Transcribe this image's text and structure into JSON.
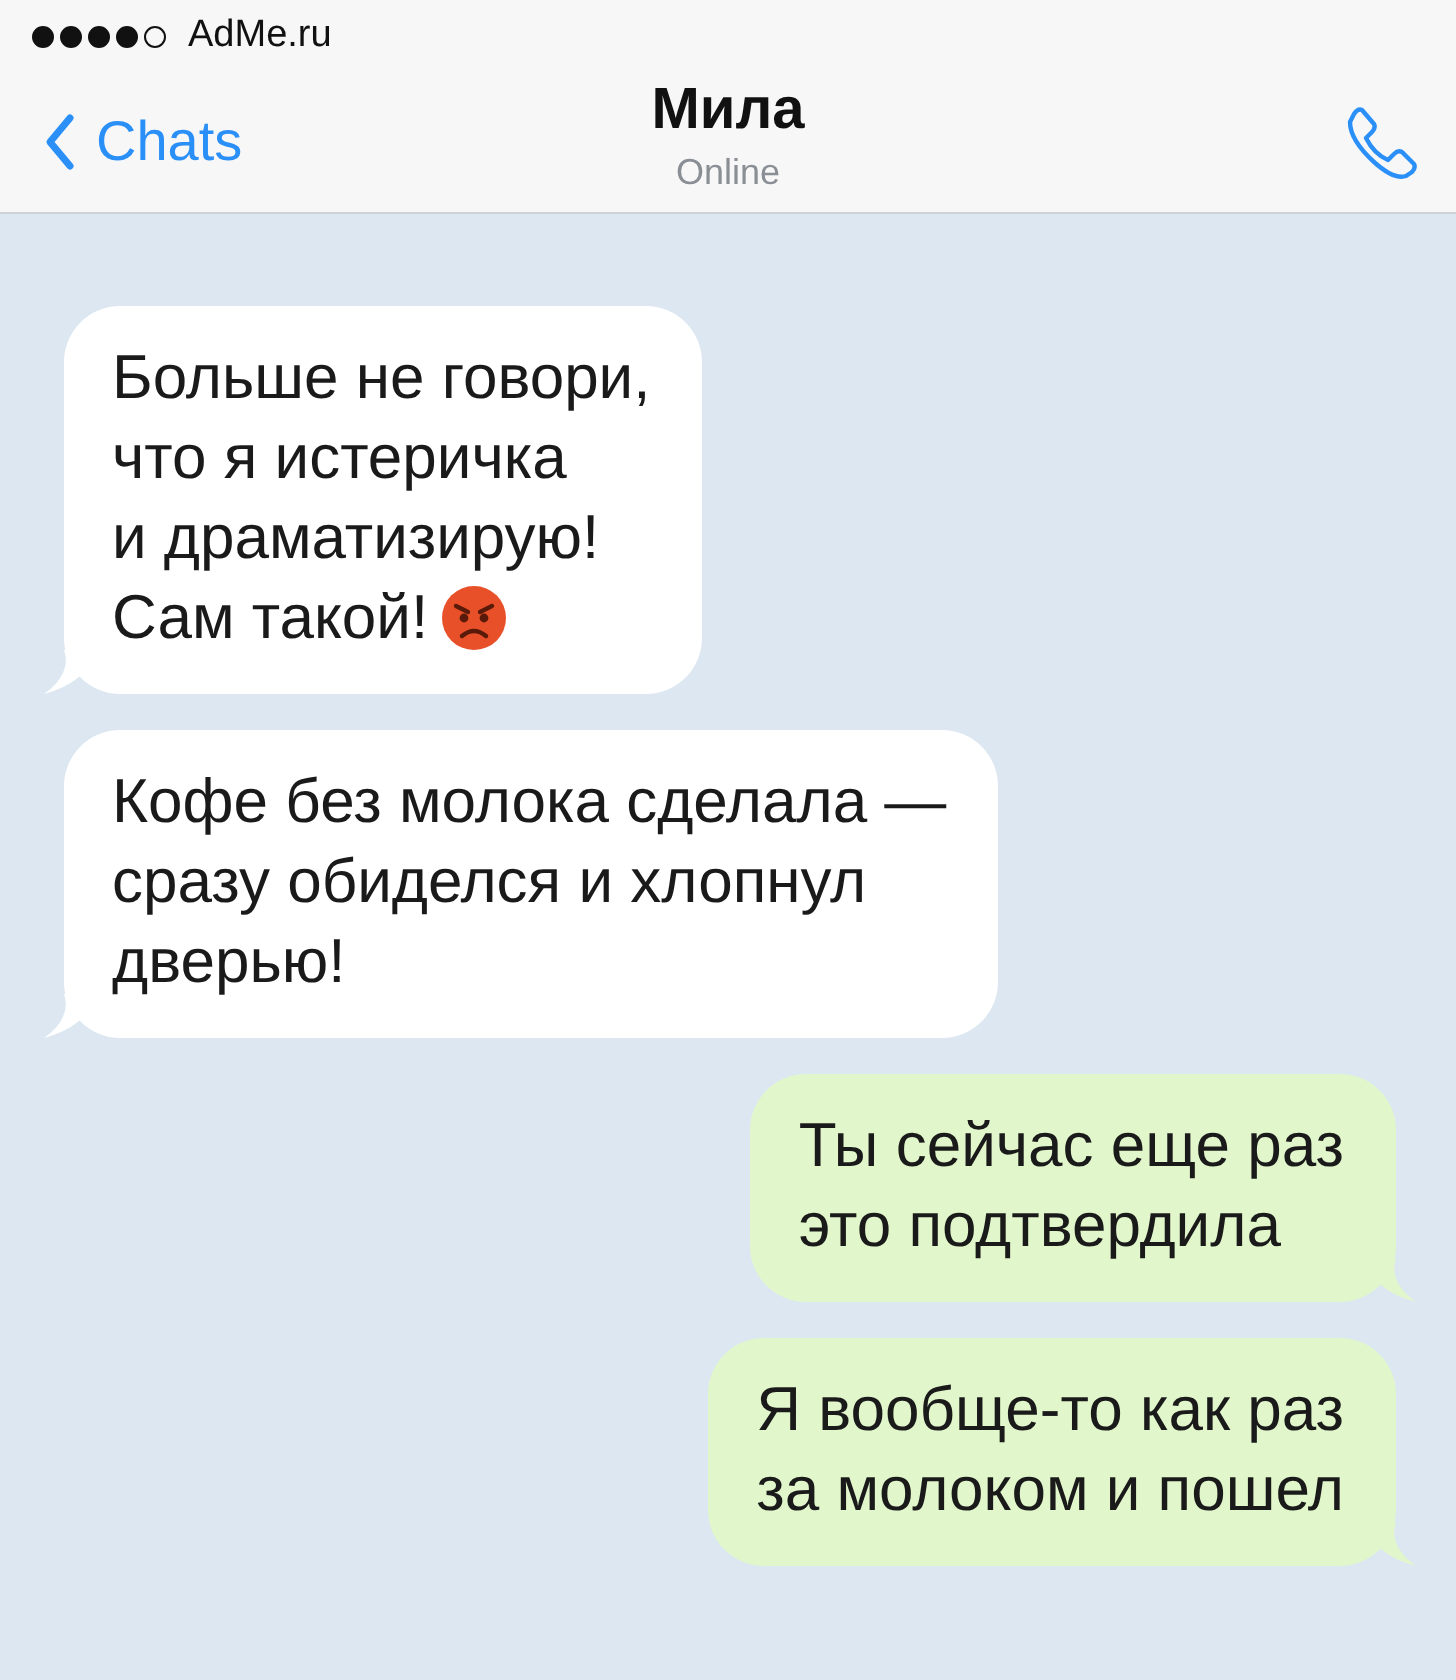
{
  "status_bar": {
    "signal_dots": [
      {
        "on": true
      },
      {
        "on": true
      },
      {
        "on": true
      },
      {
        "on": true
      },
      {
        "on": false
      }
    ],
    "carrier": "AdMe.ru"
  },
  "nav_bar": {
    "back": "Chats",
    "title": "Мила",
    "subtitle": "Online"
  },
  "messages": [
    {
      "incoming": true,
      "lines": [
        "Больше не говори,",
        "что я истеричка",
        "и драматизирую!",
        "Сам такой!"
      ],
      "emoji": true
    },
    {
      "incoming": true,
      "lines": [
        "Кофе без молока сделала —",
        "сразу обиделся и хлопнул",
        "дверью!"
      ],
      "emoji": false
    },
    {
      "incoming": false,
      "lines": [
        "Ты сейчас еще раз",
        "это подтвердила"
      ],
      "emoji": false
    },
    {
      "incoming": false,
      "lines": [
        "Я вообще-то как раз",
        "за молоком и пошел"
      ],
      "emoji": false
    }
  ]
}
